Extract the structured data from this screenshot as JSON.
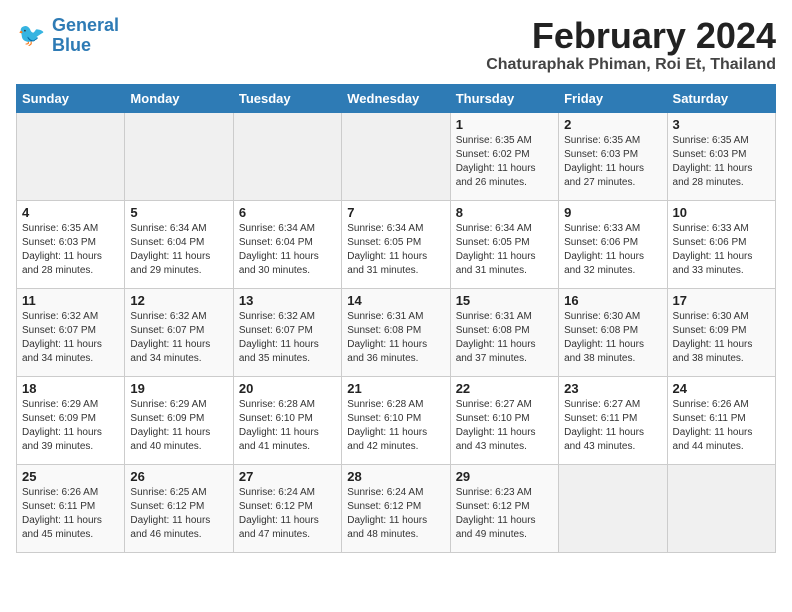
{
  "header": {
    "logo_line1": "General",
    "logo_line2": "Blue",
    "month": "February 2024",
    "location": "Chaturaphak Phiman, Roi Et, Thailand"
  },
  "days_of_week": [
    "Sunday",
    "Monday",
    "Tuesday",
    "Wednesday",
    "Thursday",
    "Friday",
    "Saturday"
  ],
  "weeks": [
    [
      {
        "day": "",
        "info": ""
      },
      {
        "day": "",
        "info": ""
      },
      {
        "day": "",
        "info": ""
      },
      {
        "day": "",
        "info": ""
      },
      {
        "day": "1",
        "info": "Sunrise: 6:35 AM\nSunset: 6:02 PM\nDaylight: 11 hours\nand 26 minutes."
      },
      {
        "day": "2",
        "info": "Sunrise: 6:35 AM\nSunset: 6:03 PM\nDaylight: 11 hours\nand 27 minutes."
      },
      {
        "day": "3",
        "info": "Sunrise: 6:35 AM\nSunset: 6:03 PM\nDaylight: 11 hours\nand 28 minutes."
      }
    ],
    [
      {
        "day": "4",
        "info": "Sunrise: 6:35 AM\nSunset: 6:03 PM\nDaylight: 11 hours\nand 28 minutes."
      },
      {
        "day": "5",
        "info": "Sunrise: 6:34 AM\nSunset: 6:04 PM\nDaylight: 11 hours\nand 29 minutes."
      },
      {
        "day": "6",
        "info": "Sunrise: 6:34 AM\nSunset: 6:04 PM\nDaylight: 11 hours\nand 30 minutes."
      },
      {
        "day": "7",
        "info": "Sunrise: 6:34 AM\nSunset: 6:05 PM\nDaylight: 11 hours\nand 31 minutes."
      },
      {
        "day": "8",
        "info": "Sunrise: 6:34 AM\nSunset: 6:05 PM\nDaylight: 11 hours\nand 31 minutes."
      },
      {
        "day": "9",
        "info": "Sunrise: 6:33 AM\nSunset: 6:06 PM\nDaylight: 11 hours\nand 32 minutes."
      },
      {
        "day": "10",
        "info": "Sunrise: 6:33 AM\nSunset: 6:06 PM\nDaylight: 11 hours\nand 33 minutes."
      }
    ],
    [
      {
        "day": "11",
        "info": "Sunrise: 6:32 AM\nSunset: 6:07 PM\nDaylight: 11 hours\nand 34 minutes."
      },
      {
        "day": "12",
        "info": "Sunrise: 6:32 AM\nSunset: 6:07 PM\nDaylight: 11 hours\nand 34 minutes."
      },
      {
        "day": "13",
        "info": "Sunrise: 6:32 AM\nSunset: 6:07 PM\nDaylight: 11 hours\nand 35 minutes."
      },
      {
        "day": "14",
        "info": "Sunrise: 6:31 AM\nSunset: 6:08 PM\nDaylight: 11 hours\nand 36 minutes."
      },
      {
        "day": "15",
        "info": "Sunrise: 6:31 AM\nSunset: 6:08 PM\nDaylight: 11 hours\nand 37 minutes."
      },
      {
        "day": "16",
        "info": "Sunrise: 6:30 AM\nSunset: 6:08 PM\nDaylight: 11 hours\nand 38 minutes."
      },
      {
        "day": "17",
        "info": "Sunrise: 6:30 AM\nSunset: 6:09 PM\nDaylight: 11 hours\nand 38 minutes."
      }
    ],
    [
      {
        "day": "18",
        "info": "Sunrise: 6:29 AM\nSunset: 6:09 PM\nDaylight: 11 hours\nand 39 minutes."
      },
      {
        "day": "19",
        "info": "Sunrise: 6:29 AM\nSunset: 6:09 PM\nDaylight: 11 hours\nand 40 minutes."
      },
      {
        "day": "20",
        "info": "Sunrise: 6:28 AM\nSunset: 6:10 PM\nDaylight: 11 hours\nand 41 minutes."
      },
      {
        "day": "21",
        "info": "Sunrise: 6:28 AM\nSunset: 6:10 PM\nDaylight: 11 hours\nand 42 minutes."
      },
      {
        "day": "22",
        "info": "Sunrise: 6:27 AM\nSunset: 6:10 PM\nDaylight: 11 hours\nand 43 minutes."
      },
      {
        "day": "23",
        "info": "Sunrise: 6:27 AM\nSunset: 6:11 PM\nDaylight: 11 hours\nand 43 minutes."
      },
      {
        "day": "24",
        "info": "Sunrise: 6:26 AM\nSunset: 6:11 PM\nDaylight: 11 hours\nand 44 minutes."
      }
    ],
    [
      {
        "day": "25",
        "info": "Sunrise: 6:26 AM\nSunset: 6:11 PM\nDaylight: 11 hours\nand 45 minutes."
      },
      {
        "day": "26",
        "info": "Sunrise: 6:25 AM\nSunset: 6:12 PM\nDaylight: 11 hours\nand 46 minutes."
      },
      {
        "day": "27",
        "info": "Sunrise: 6:24 AM\nSunset: 6:12 PM\nDaylight: 11 hours\nand 47 minutes."
      },
      {
        "day": "28",
        "info": "Sunrise: 6:24 AM\nSunset: 6:12 PM\nDaylight: 11 hours\nand 48 minutes."
      },
      {
        "day": "29",
        "info": "Sunrise: 6:23 AM\nSunset: 6:12 PM\nDaylight: 11 hours\nand 49 minutes."
      },
      {
        "day": "",
        "info": ""
      },
      {
        "day": "",
        "info": ""
      }
    ]
  ]
}
